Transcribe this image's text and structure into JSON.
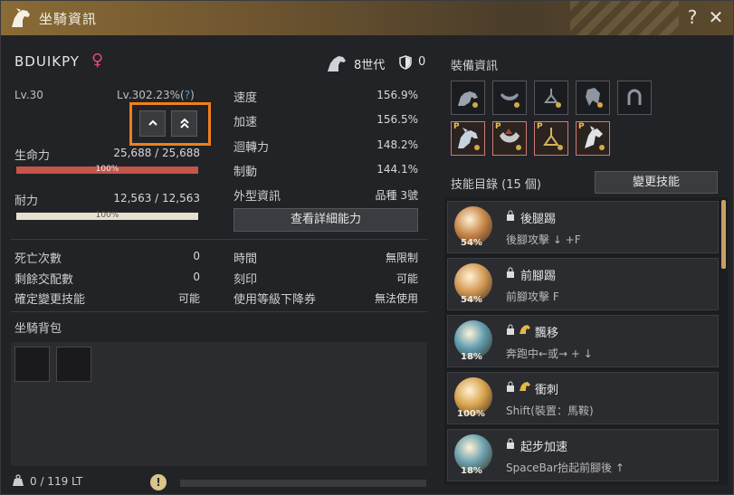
{
  "window": {
    "title": "坐騎資訊",
    "help_label": "?",
    "close_label": "✕"
  },
  "mount": {
    "name": "BDUIKPY",
    "gender_symbol": "♀",
    "generation": "8世代",
    "defense": "0",
    "level": "Lv.30",
    "level_exp": "Lv.302.23%(",
    "level_exp_q": "?",
    "level_exp_close": ")"
  },
  "stats_left": {
    "hp_label": "生命力",
    "hp_value": "25,688 / 25,688",
    "hp_pct": "100%",
    "hp_fill": 1.0,
    "st_label": "耐力",
    "st_value": "12,563 / 12,563",
    "st_pct": "100%",
    "st_fill": 1.0,
    "rows": [
      {
        "label": "死亡次數",
        "value": "0"
      },
      {
        "label": "剩餘交配數",
        "value": "0"
      },
      {
        "label": "確定變更技能",
        "value": "可能"
      }
    ]
  },
  "stats_right": {
    "rows": [
      {
        "label": "速度",
        "value": "156.9%"
      },
      {
        "label": "加速",
        "value": "156.5%"
      },
      {
        "label": "迴轉力",
        "value": "148.2%"
      },
      {
        "label": "制動",
        "value": "144.1%"
      },
      {
        "label": "外型資訊",
        "value": "品種 3號"
      }
    ],
    "detail_button": "查看詳細能力",
    "rows2": [
      {
        "label": "時間",
        "value": "無限制"
      },
      {
        "label": "刻印",
        "value": "可能"
      },
      {
        "label": "使用等級下降券",
        "value": "無法使用"
      }
    ]
  },
  "bag": {
    "title": "坐騎背包",
    "weight": "0 / 119 LT",
    "warn": "!",
    "weight_fill": 0.0
  },
  "equipment": {
    "title": "裝備資訊",
    "pearl_marker": "P"
  },
  "skills": {
    "title": "技能目錄 (15 個)",
    "change_button": "變更技能",
    "items": [
      {
        "name": "後腿踢",
        "desc": "後腳攻擊 ↓ +F",
        "pct": "54%",
        "color": "#c8874a"
      },
      {
        "name": "前腳踢",
        "desc": "前腳攻擊 F",
        "pct": "54%",
        "color": "#d49a55"
      },
      {
        "name": "飄移",
        "desc": "奔跑中←或→ + ↓",
        "pct": "18%",
        "color": "#5f9bb0"
      },
      {
        "name": "衝刺",
        "desc": "Shift(裝置：馬鞍)",
        "pct": "100%",
        "color": "#d8a24d"
      },
      {
        "name": "起步加速",
        "desc": "SpaceBar抬起前腳後 ↑",
        "pct": "18%",
        "color": "#6aa0ae"
      }
    ]
  },
  "colors": {
    "accent": "#f07f1b",
    "hp": "#c4554a",
    "stamina": "#e6e1cf",
    "titlebar": "#8a6b35"
  }
}
